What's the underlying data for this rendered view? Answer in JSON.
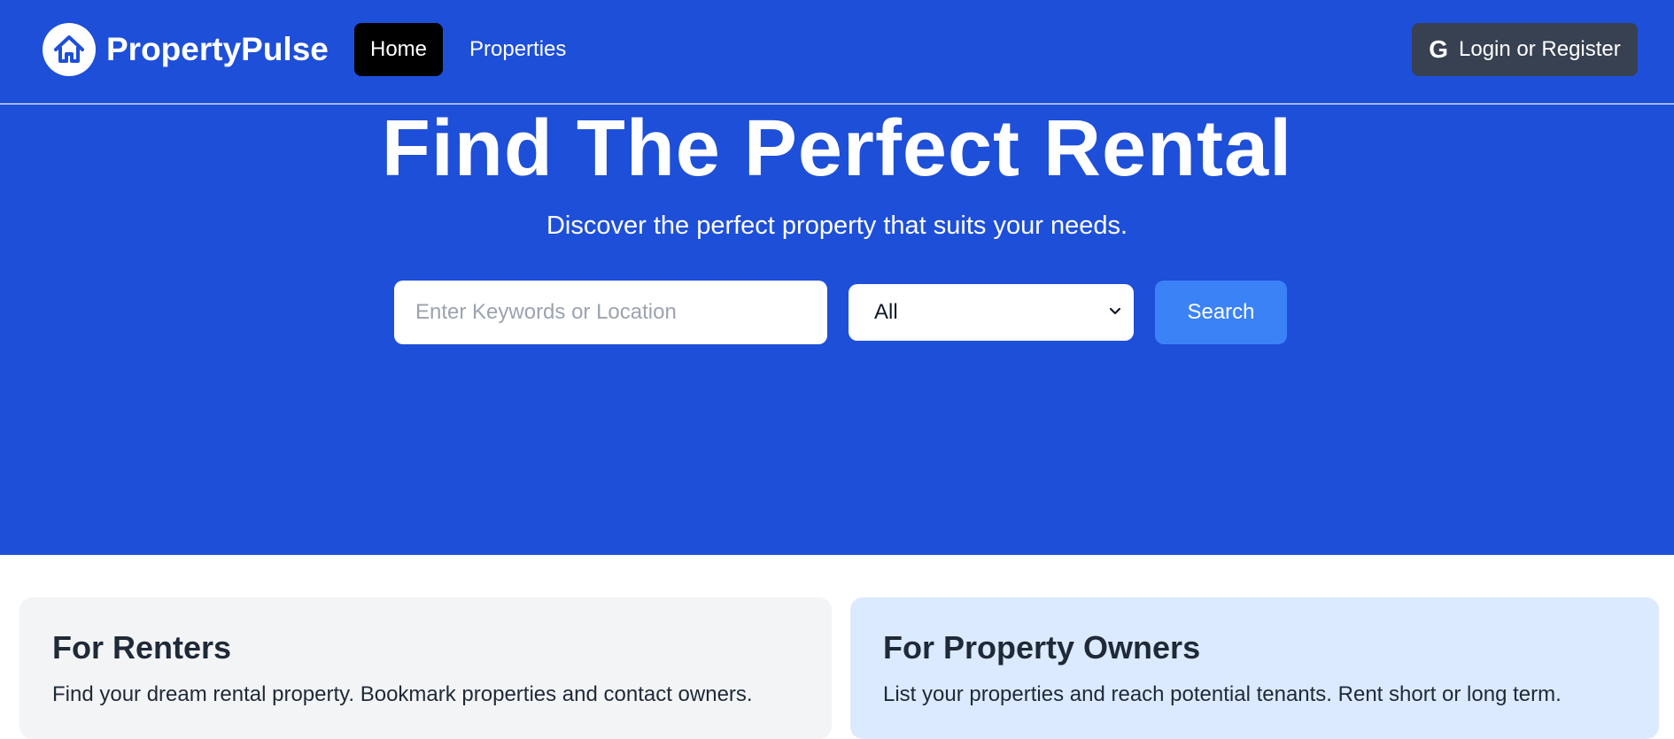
{
  "header": {
    "brand_name": "PropertyPulse",
    "logo_icon": "house-icon",
    "nav": [
      {
        "label": "Home",
        "active": true
      },
      {
        "label": "Properties",
        "active": false
      }
    ],
    "login_label": "Login or Register",
    "login_icon": "google-icon"
  },
  "hero": {
    "title": "Find The Perfect Rental",
    "subtitle": "Discover the perfect property that suits your needs.",
    "search": {
      "placeholder": "Enter Keywords or Location",
      "value": "",
      "type_selected": "All",
      "button_label": "Search"
    }
  },
  "cards": [
    {
      "title": "For Renters",
      "text": "Find your dream rental property. Bookmark properties and contact owners."
    },
    {
      "title": "For Property Owners",
      "text": "List your properties and reach potential tenants. Rent short or long term."
    }
  ],
  "colors": {
    "primary": "#1e4fd8",
    "nav_active": "#000000",
    "login_button": "#374151",
    "search_button": "#3b82f6",
    "renters_card": "#f3f4f6",
    "owners_card": "#dbeafe"
  }
}
